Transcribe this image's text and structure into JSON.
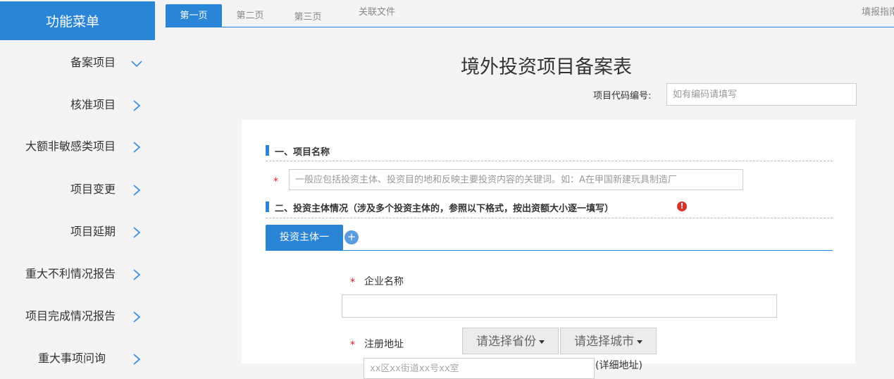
{
  "sidebar": {
    "header": "功能菜单",
    "items": [
      {
        "label": "备案项目",
        "arrow": "chevron-down-icon"
      },
      {
        "label": "核准项目",
        "arrow": "chevron-right-icon"
      },
      {
        "label": "大额非敏感类项目",
        "arrow": "chevron-right-icon"
      },
      {
        "label": "项目变更",
        "arrow": "chevron-right-icon"
      },
      {
        "label": "项目延期",
        "arrow": "chevron-right-icon"
      },
      {
        "label": "重大不利情况报告",
        "arrow": "chevron-right-icon"
      },
      {
        "label": "项目完成情况报告",
        "arrow": "chevron-right-icon"
      },
      {
        "label": "重大事项问询",
        "arrow": "chevron-right-icon"
      }
    ]
  },
  "tabs": [
    {
      "label": "第一页",
      "active": true
    },
    {
      "label": "第二页",
      "active": false
    },
    {
      "label": "第三页",
      "active": false
    },
    {
      "label": "关联文件",
      "active": false
    }
  ],
  "guide_link": "填报指南",
  "form": {
    "title": "境外投资项目备案表",
    "code_label": "项目代码编号:",
    "code_placeholder": "如有编码请填写",
    "section1_title": "一、项目名称",
    "section1_required": "*",
    "name_placeholder": "一般应包括投资主体、投资目的地和反映主要投资内容的关键词。如：A在甲国新建玩具制造厂",
    "section2_title": "二、投资主体情况（涉及多个投资主体的，参照以下格式，按出资额大小逐一填写）",
    "warn_glyph": "!",
    "subtab_label": "投资主体一",
    "add_glyph": "+",
    "company_required": "*",
    "company_label": "企业名称",
    "address_required": "*",
    "address_label": "注册地址",
    "province_select": "请选择省份",
    "city_select": "请选择城市",
    "address_placeholder": "xx区xx街道xx号xx室",
    "address_hint": "(详细地址)"
  },
  "colors": {
    "accent": "#2a85d7",
    "required": "#e02020",
    "warning": "#d9342b"
  }
}
